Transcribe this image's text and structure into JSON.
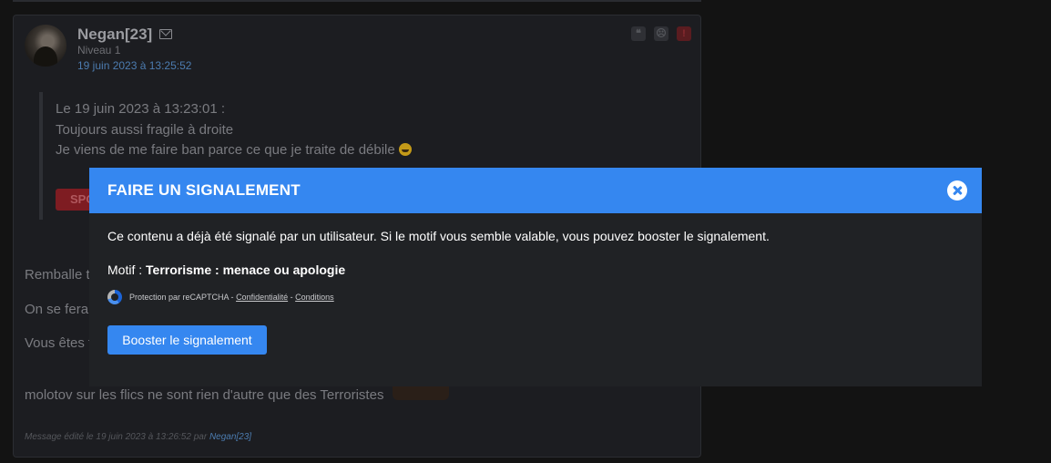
{
  "post": {
    "author": "Negan[23]",
    "level": "Niveau 1",
    "date": "19 juin 2023 à 13:25:52",
    "tool_icons": [
      "quote-icon",
      "sad-icon",
      "alert-icon"
    ],
    "quote": {
      "header": "Le 19 juin 2023 à 13:23:01 :",
      "line1": "Toujours aussi fragile à droite",
      "line2": "Je viens de me faire ban parce ce que je traite de débile",
      "spoiler_label": "SPO"
    },
    "body": {
      "line1": "Remballe t",
      "line2": "On se ferai",
      "line3": "Vous êtes t",
      "line4": "molotov sur les flics ne sont rien d'autre que des Terroristes"
    },
    "edited": {
      "prefix": "Message édité le 19 juin 2023 à 13:26:52 par",
      "by": "Negan[23]"
    }
  },
  "modal": {
    "title": "FAIRE UN SIGNALEMENT",
    "description": "Ce contenu a déjà été signalé par un utilisateur. Si le motif vous semble valable, vous pouvez booster le signalement.",
    "reason_label": "Motif :",
    "reason_value": "Terrorisme : menace ou apologie",
    "recaptcha": {
      "text": "Protection par reCAPTCHA -",
      "privacy_link": "Confidentialité",
      "separator": "-",
      "terms_link": "Conditions"
    },
    "boost_button": "Booster le signalement"
  },
  "colors": {
    "accent": "#3587f0",
    "background": "#131313",
    "card": "#1c1d21",
    "modal": "#202225",
    "link": "#4c7cb0"
  }
}
